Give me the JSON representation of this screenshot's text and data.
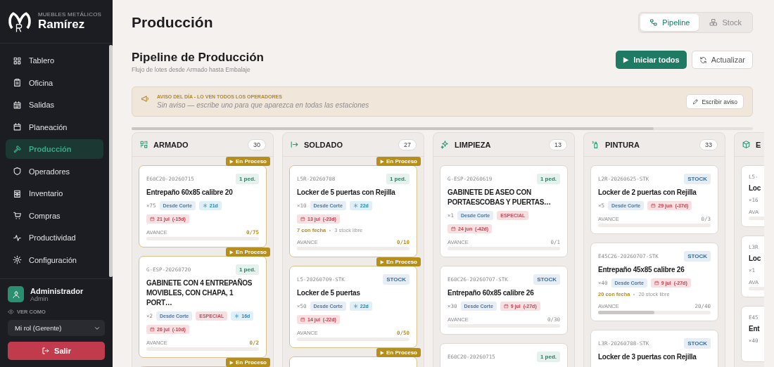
{
  "sidebar": {
    "brand_top": "MUEBLES METÁLICOS",
    "brand_name": "Ramírez",
    "items": [
      {
        "label": "Tablero",
        "selected": false
      },
      {
        "label": "Oficina",
        "selected": false
      },
      {
        "label": "Salidas",
        "selected": false
      },
      {
        "label": "Planeación",
        "selected": false
      },
      {
        "label": "Producción",
        "selected": true
      },
      {
        "label": "Operadores",
        "selected": false
      },
      {
        "label": "Inventario",
        "selected": false
      },
      {
        "label": "Compras",
        "selected": false
      },
      {
        "label": "Productividad",
        "selected": false
      },
      {
        "label": "Configuración",
        "selected": false
      }
    ],
    "user": {
      "name": "Administrador",
      "role": "Admin"
    },
    "view_as": {
      "label": "VER COMO",
      "value": "Mi rol (Gerente)"
    },
    "logout": "Salir"
  },
  "header": {
    "title": "Producción",
    "views": [
      {
        "label": "Pipeline",
        "selected": true
      },
      {
        "label": "Stock",
        "selected": false
      }
    ]
  },
  "section": {
    "title": "Pipeline de Producción",
    "subtitle": "Flujo de lotes desde Armado hasta Embalaje",
    "actions": [
      {
        "kind": "primary",
        "label": "Iniciar todos"
      },
      {
        "kind": "secondary",
        "label": "Actualizar"
      }
    ]
  },
  "notice": {
    "heading": "AVISO DEL DÍA - LO VEN TODOS LOS OPERADORES",
    "text": "Sin aviso — escribe uno para que aparezca en todas las estaciones",
    "button": "Escribir aviso"
  },
  "board": {
    "columns": [
      {
        "name": "ARMADO",
        "count": "30",
        "cards": [
          {
            "status": "En Proceso",
            "id": "E60C20-20260715",
            "tag": {
              "kind": "orders",
              "text": "1 ped."
            },
            "title": "Entrepaño 60x85 calibre 20",
            "qty": "×75",
            "chips": [
              {
                "kind": "source",
                "text": "Desde Corte"
              },
              {
                "kind": "cold",
                "text": "21d"
              },
              {
                "kind": "date",
                "text": "21 jul  (-15d)"
              }
            ],
            "progress": {
              "label": "AVANCE",
              "reading": "0/75",
              "level": 0
            }
          },
          {
            "status": "En Proceso",
            "id": "G-ESP-20260720",
            "tag": {
              "kind": "orders",
              "text": "1 ped."
            },
            "title": "GABINETE CON 4 ENTREPAÑOS MOVIBLES, CON CHAPA, 1 PORT…",
            "qty": "×2",
            "chips": [
              {
                "kind": "source",
                "text": "Desde Corte"
              },
              {
                "kind": "special",
                "text": "ESPECIAL"
              },
              {
                "kind": "cold",
                "text": "16d"
              },
              {
                "kind": "date",
                "text": "26 jul  (-10d)"
              }
            ],
            "progress": {
              "label": "AVANCE",
              "reading": "0/2",
              "level": 0
            }
          },
          {
            "status": "En Proceso"
          }
        ]
      },
      {
        "name": "SOLDADO",
        "count": "27",
        "cards": [
          {
            "status": "En Proceso",
            "id": "L5R-20260708",
            "tag": {
              "kind": "orders",
              "text": "1 ped."
            },
            "title": "Locker de 5 puertas con Rejilla",
            "qty": "×10",
            "chips": [
              {
                "kind": "source",
                "text": "Desde Corte"
              },
              {
                "kind": "cold",
                "text": "22d"
              },
              {
                "kind": "date",
                "text": "13 jul  (-23d)"
              }
            ],
            "split": {
              "dated": "7 con fecha",
              "free": "3 stock libre"
            },
            "progress": {
              "label": "AVANCE",
              "reading": "0/10",
              "level": 0
            }
          },
          {
            "status": "En Proceso",
            "id": "L5-20260709-STK",
            "tag": {
              "kind": "stock",
              "text": "STOCK"
            },
            "title": "Locker de 5 puertas",
            "qty": "×50",
            "chips": [
              {
                "kind": "source",
                "text": "Desde Corte"
              },
              {
                "kind": "cold",
                "text": "22d"
              },
              {
                "kind": "date",
                "text": "14 jul  (-22d)"
              }
            ],
            "progress": {
              "label": "AVANCE",
              "reading": "0/50",
              "level": 0
            }
          },
          {
            "status": "En Proceso"
          }
        ]
      },
      {
        "name": "LIMPIEZA",
        "count": "13",
        "cards": [
          {
            "id": "G-ESP-20260619",
            "tag": {
              "kind": "orders",
              "text": "1 ped."
            },
            "title": "GABINETE DE ASEO CON PORTAESCOBAS Y PUERTAS…",
            "qty": "×1",
            "chips": [
              {
                "kind": "source",
                "text": "Desde Corte"
              },
              {
                "kind": "special",
                "text": "ESPECIAL"
              },
              {
                "kind": "date",
                "text": "24 jun  (-42d)"
              }
            ],
            "progress": {
              "label": "AVANCE",
              "reading": "0/1",
              "level": 0
            }
          },
          {
            "id": "E60C26-20260707-STK",
            "tag": {
              "kind": "stock",
              "text": "STOCK"
            },
            "title": "Entrepaño 60x85 calibre 26",
            "qty": "×30",
            "chips": [
              {
                "kind": "source",
                "text": "Desde Corte"
              },
              {
                "kind": "date",
                "text": "9 jul  (-27d)"
              }
            ],
            "progress": {
              "label": "AVANCE",
              "reading": "0/30",
              "level": 0
            }
          },
          {
            "id": "E60C20-20260715",
            "tag": {
              "kind": "orders",
              "text": "1 ped."
            }
          }
        ]
      },
      {
        "name": "PINTURA",
        "count": "33",
        "cards": [
          {
            "id": "L2R-20260625-STK",
            "tag": {
              "kind": "stock",
              "text": "STOCK"
            },
            "title": "Locker de 2 puertas con Rejilla",
            "qty": "×5",
            "chips": [
              {
                "kind": "source",
                "text": "Desde Corte"
              },
              {
                "kind": "date",
                "text": "29 jun  (-37d)"
              }
            ],
            "progress": {
              "label": "AVANCE",
              "reading": "0/3",
              "level": 0
            }
          },
          {
            "id": "E45C26-20260707-STK",
            "tag": {
              "kind": "stock",
              "text": "STOCK"
            },
            "title": "Entrepaño 45x85 calibre 26",
            "qty": "×40",
            "chips": [
              {
                "kind": "source",
                "text": "Desde Corte"
              },
              {
                "kind": "date",
                "text": "9 jul  (-27d)"
              }
            ],
            "split": {
              "dated": "20 con fecha",
              "free": "20 stock libre"
            },
            "progress": {
              "label": "AVANCE",
              "reading": "20/40",
              "level": 0.5
            }
          },
          {
            "id": "L3R-20260708-STK",
            "tag": {
              "kind": "stock",
              "text": "STOCK"
            },
            "title": "Locker de 3 puertas con Rejilla"
          }
        ]
      },
      {
        "name": "E",
        "cards": [
          {
            "id": "L5-",
            "title": "Loc",
            "qty": "×16",
            "progress": {
              "label": "AVA",
              "level": 0
            }
          },
          {
            "id": "L3R",
            "title": "Loc",
            "qty": "×1",
            "progress": {
              "label": "AVA",
              "level": 0
            }
          },
          {
            "id": "E45",
            "title": "Ent",
            "qty": "×40"
          }
        ]
      }
    ]
  }
}
